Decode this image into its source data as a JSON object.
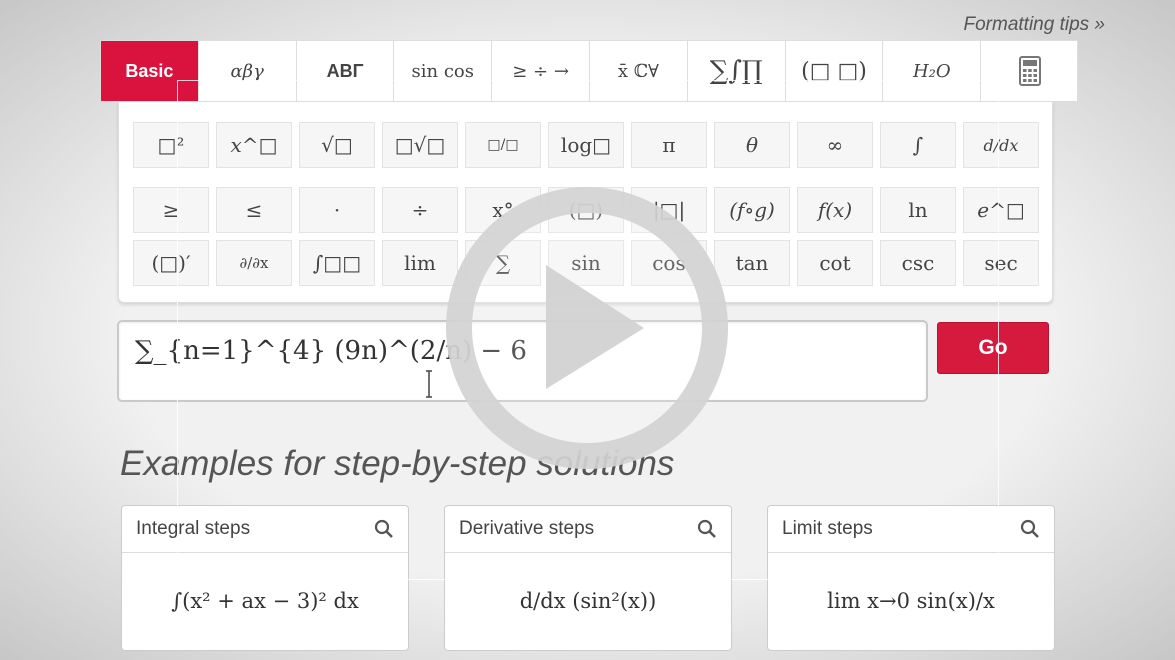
{
  "formatting_tips": "Formatting tips »",
  "tabs": [
    "Basic",
    "αβγ",
    "ΑΒΓ",
    "sin cos",
    "≥ ÷ →",
    "x̄ ℂ∀",
    "∑∫∏",
    "(□ □)",
    "H₂O",
    "calculator"
  ],
  "active_tab": "Basic",
  "keys_row1": [
    "□²",
    "x^□",
    "√□",
    "□√□",
    "□/□",
    "log□",
    "π",
    "θ",
    "∞",
    "∫",
    "d/dx"
  ],
  "keys_row2": [
    "≥",
    "≤",
    "·",
    "÷",
    "x°",
    "(□)",
    "|□|",
    "(f∘g)",
    "f(x)",
    "ln",
    "e^□"
  ],
  "keys_row3": [
    "(□)′",
    "∂/∂x",
    "∫□□",
    "lim",
    "∑",
    "sin",
    "cos",
    "tan",
    "cot",
    "csc",
    "sec"
  ],
  "input": {
    "expression": "∑_{n=1}^{4} (9n)^(2/n) − 6"
  },
  "go_label": "Go",
  "examples_title": "Examples for step-by-step solutions",
  "examples": [
    {
      "title": "Integral steps",
      "formula": "∫(x² + ax − 3)² dx"
    },
    {
      "title": "Derivative steps",
      "formula": "d/dx (sin²(x))"
    },
    {
      "title": "Limit steps",
      "formula": "lim x→0 sin(x)/x"
    }
  ],
  "colors": {
    "accent": "#d9123e",
    "background": "#f2f1f1",
    "text": "#444444"
  }
}
